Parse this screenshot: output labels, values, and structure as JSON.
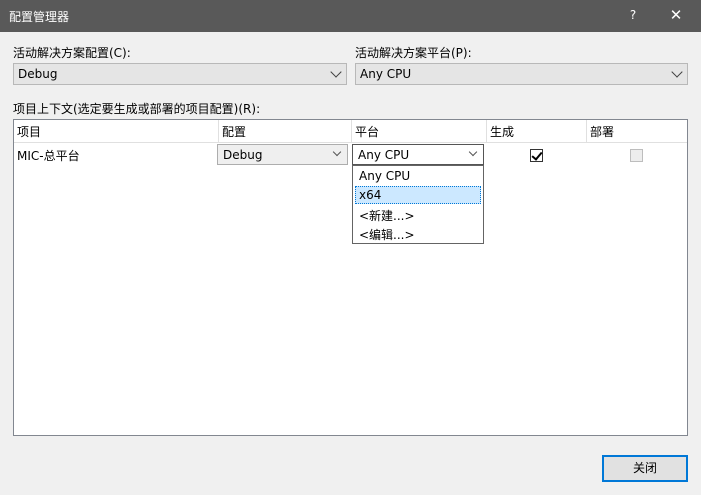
{
  "window": {
    "title": "配置管理器",
    "help_label": "?",
    "close_label": "✕"
  },
  "solution_config": {
    "label": "活动解决方案配置(C):",
    "value": "Debug"
  },
  "solution_platform": {
    "label": "活动解决方案平台(P):",
    "value": "Any CPU"
  },
  "project_context": {
    "label": "项目上下文(选定要生成或部署的项目配置)(R):"
  },
  "grid": {
    "columns": [
      "项目",
      "配置",
      "平台",
      "生成",
      "部署"
    ],
    "rows": [
      {
        "project": "MIC-总平台",
        "config": "Debug",
        "platform": "Any CPU",
        "build": true,
        "deploy": false
      }
    ]
  },
  "platform_dropdown": {
    "options": [
      "Any CPU",
      "x64",
      "<新建...>",
      "<编辑...>"
    ],
    "selected": "x64"
  },
  "buttons": {
    "close": "关闭"
  },
  "colors": {
    "titlebar": "#595959",
    "accent": "#0078d7",
    "selection": "#cce8ff"
  }
}
